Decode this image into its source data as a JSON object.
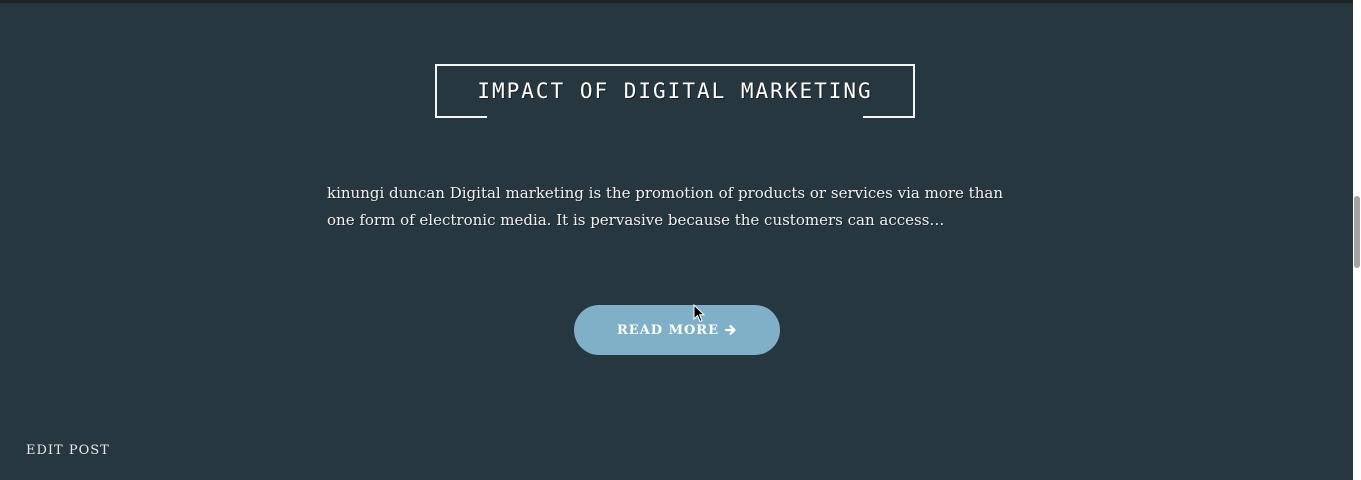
{
  "post": {
    "title": "IMPACT OF DIGITAL MARKETING",
    "excerpt": "kinungi duncan Digital marketing is the promotion of products or services via more than one form of electronic media. It is pervasive because the customers can access…",
    "read_more_label": "READ MORE",
    "read_more_icon": "arrow-right-icon",
    "edit_label": "EDIT POST"
  },
  "colors": {
    "background": "#27373f",
    "button": "#7fb0c8",
    "text": "#f2f2f2"
  }
}
